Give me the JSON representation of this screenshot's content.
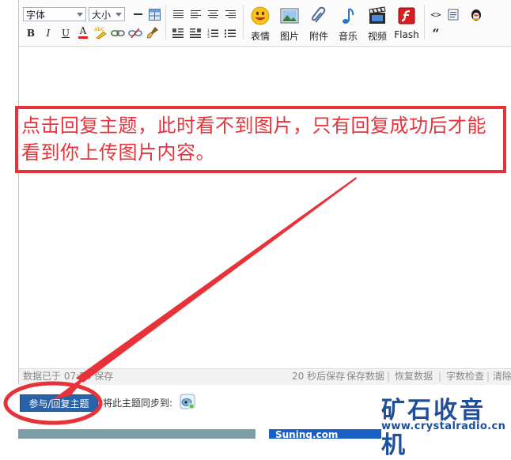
{
  "toolbar": {
    "font_select": "字体",
    "size_select": "大小",
    "buttons": {
      "emoticon": "表情",
      "image": "图片",
      "attachment": "附件",
      "music": "音乐",
      "video": "视频",
      "flash": "Flash"
    },
    "small": {
      "bold": "B",
      "italic": "I",
      "underline": "U",
      "font_color": "A",
      "spellcheck": "abc",
      "quote": "“",
      "code": "<>"
    }
  },
  "statusbar": {
    "saved_info": "数据已于 07:58 保存",
    "autosave": "20 秒后保存",
    "save_data": "保存数据",
    "restore_data": "恢复数据",
    "char_check": "字数检查",
    "clear": "清除"
  },
  "annotation": {
    "text": "点击回复主题，此时看不到图片，只有回复成功后才能看到你上传图片内容。",
    "color": "#e8323a"
  },
  "reply": {
    "button_label": "参与/回复主题",
    "sync_label": "将此主题同步到:"
  },
  "watermark": {
    "brand": "矿石收音机",
    "url": "www.crystalradio.cn"
  },
  "bottom": {
    "partner": "Suning.com"
  },
  "colors": {
    "annotation_red": "#e8323a",
    "button_blue": "#2a62a8",
    "brand_blue": "#1e4e9c"
  }
}
